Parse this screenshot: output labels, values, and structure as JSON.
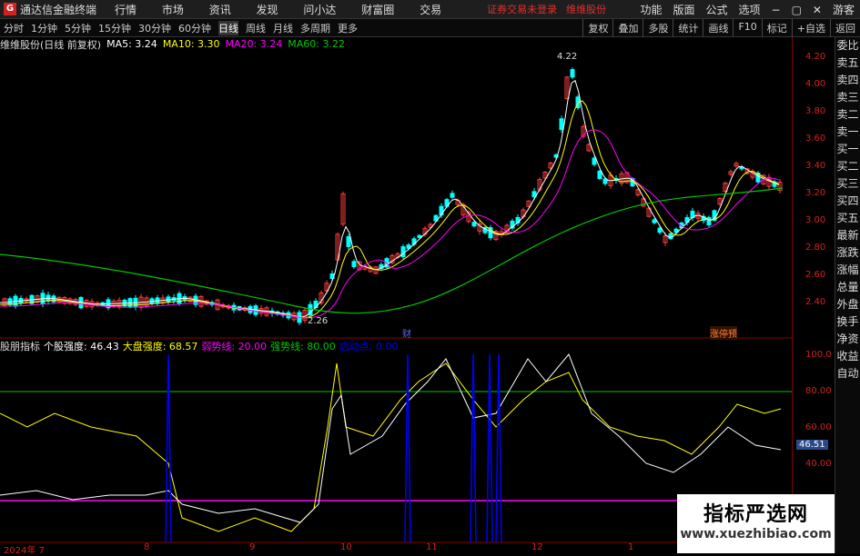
{
  "titlebar": {
    "logo": "G",
    "app_title": "通达信金融终端",
    "menu": [
      "行情",
      "市场",
      "资讯",
      "发现",
      "问小达",
      "财富圈",
      "交易"
    ],
    "warning": "证券交易未登录",
    "stock_name_bar": "维维股份",
    "right_menu": [
      "功能",
      "版面",
      "公式",
      "选项"
    ],
    "window_controls": [
      "−",
      "▢",
      "✕"
    ],
    "guest": "游客"
  },
  "toolbar": {
    "periods": [
      "分时",
      "1分钟",
      "5分钟",
      "15分钟",
      "30分钟",
      "60分钟",
      "日线",
      "周线",
      "月线",
      "多周期",
      "更多"
    ],
    "active_period": "日线",
    "right_buttons": [
      "复权",
      "叠加",
      "多股",
      "统计",
      "画线",
      "F10",
      "标记",
      "+自选",
      "返回"
    ]
  },
  "info": {
    "stock": "维维股份(日线 前复权)",
    "ma5": "MA5: 3.24",
    "ma10": "MA10: 3.30",
    "ma20": "MA20: 3.24",
    "ma60": "MA60: 3.22"
  },
  "price_axis": [
    "4.20",
    "4.00",
    "3.80",
    "3.60",
    "3.40",
    "3.20",
    "3.00",
    "2.80",
    "2.60",
    "2.40"
  ],
  "indicator_axis": [
    "100.0",
    "80.00",
    "60.00",
    "40.00"
  ],
  "indicator_current": "46.51",
  "annotations": {
    "high": "4.22",
    "low": "2.26",
    "cai": "财",
    "zhangting": "涨停预"
  },
  "lower": {
    "name": "股朋指标",
    "individual": "个股强度: 46.43",
    "market": "大盘强度: 68.57",
    "weak": "弱势线: 20.00",
    "strong": "强势线: 80.00",
    "launch": "启动点: 0.00"
  },
  "xaxis": [
    "2024年 7",
    "8",
    "9",
    "10",
    "11",
    "12",
    "1"
  ],
  "sidebar": [
    "委比",
    "卖五",
    "卖四",
    "卖三",
    "卖二",
    "卖一",
    "买一",
    "买二",
    "买三",
    "买四",
    "买五",
    "最新",
    "涨跌",
    "涨幅",
    "总量",
    "外盘",
    "换手",
    "净资",
    "收益",
    "自动"
  ],
  "watermark": {
    "line1": "指标严选网",
    "line2": "www.xuezhibiao.com"
  },
  "colors": {
    "up": "#ff3b3b",
    "down": "#00ffff",
    "ma5": "#ffffff",
    "ma10": "#ffff00",
    "ma20": "#ff00ff",
    "ma60": "#00c800",
    "strength_line": "#ffff00",
    "indicator_blue": "#0000ff"
  }
}
